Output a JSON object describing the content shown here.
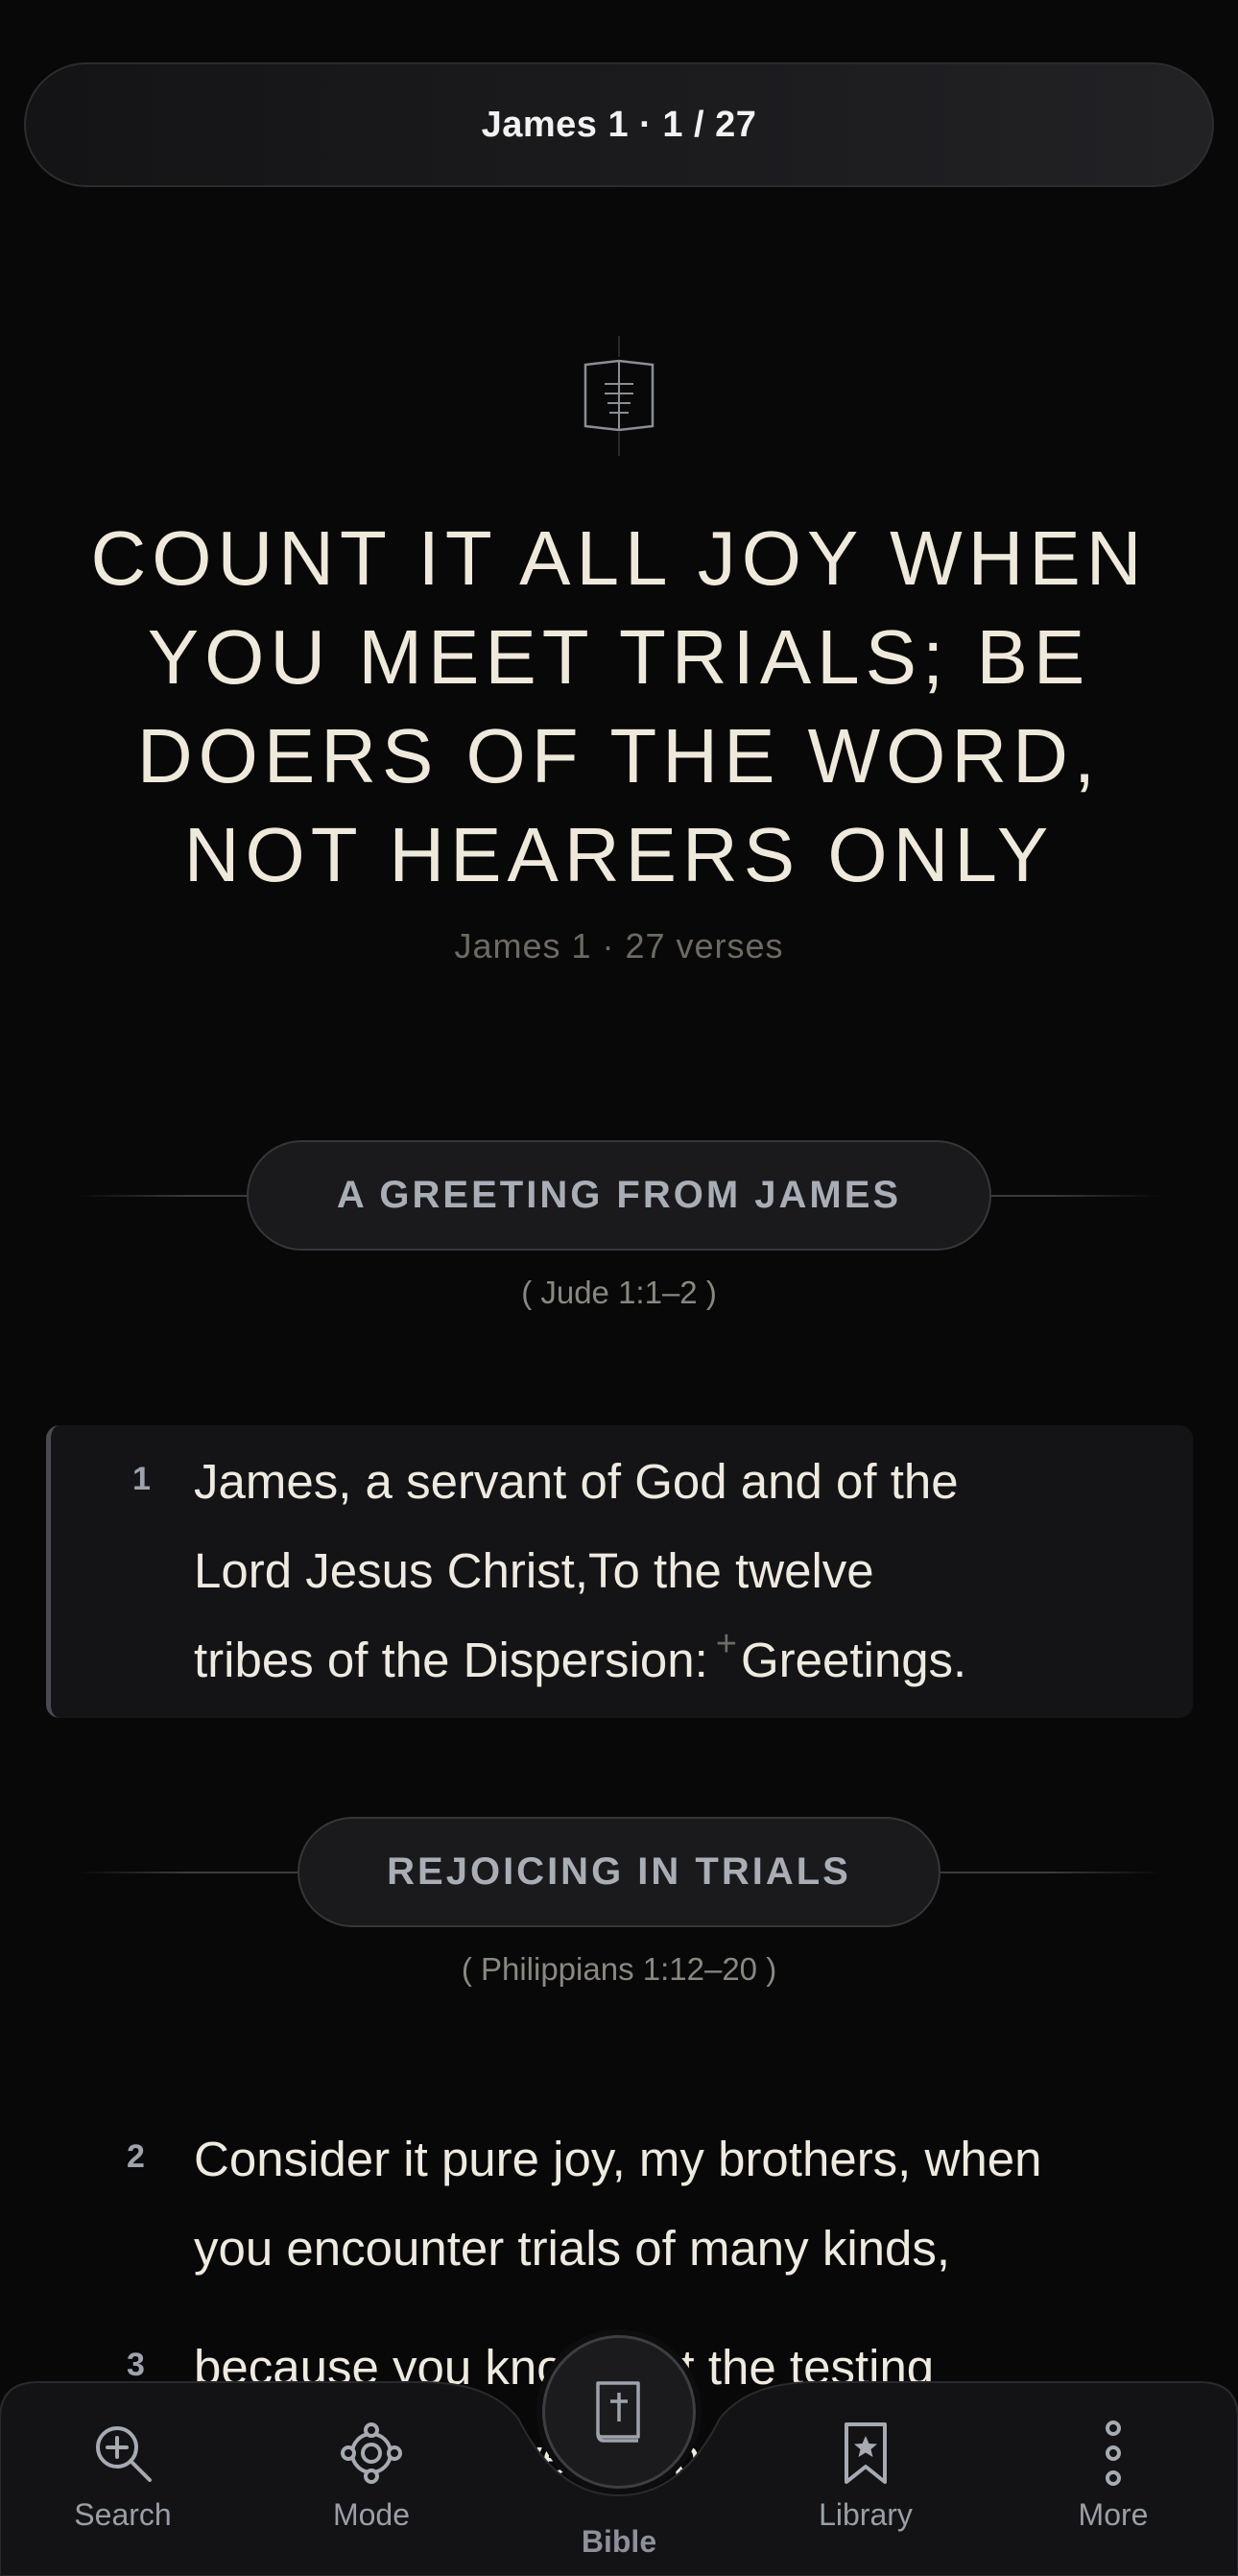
{
  "header": {
    "location": "James 1 · 1 / 27"
  },
  "chapter": {
    "title_lines": [
      "COUNT IT ALL JOY WHEN",
      "YOU MEET TRIALS; BE",
      "DOERS OF THE WORD,",
      "NOT HEARERS ONLY"
    ],
    "subtitle": "James 1 · 27 verses"
  },
  "sections": [
    {
      "heading": "A GREETING FROM JAMES",
      "crossref": "( Jude 1:1–2 )"
    },
    {
      "heading": "REJOICING IN TRIALS",
      "crossref": "( Philippians 1:12–20 )"
    }
  ],
  "verses": [
    {
      "number": "1",
      "lines": [
        "James, a servant of God and of the",
        "Lord Jesus Christ,To the twelve",
        "tribes of the Dispersion:"
      ],
      "footnote_mark": "+",
      "tail": "Greetings."
    },
    {
      "number": "2",
      "lines": [
        "Consider it pure joy, my brothers, when",
        "you encounter trials of many kinds,"
      ]
    },
    {
      "number": "3",
      "lines": [
        "because you know that the testing",
        "of your faith develops perseverance."
      ]
    }
  ],
  "nav": {
    "items": [
      {
        "label": "Search",
        "icon": "search-plus-icon"
      },
      {
        "label": "Mode",
        "icon": "mode-icon"
      },
      {
        "label": "Bible",
        "icon": "bible-icon"
      },
      {
        "label": "Library",
        "icon": "bookmark-star-icon"
      },
      {
        "label": "More",
        "icon": "more-vertical-icon"
      }
    ]
  }
}
